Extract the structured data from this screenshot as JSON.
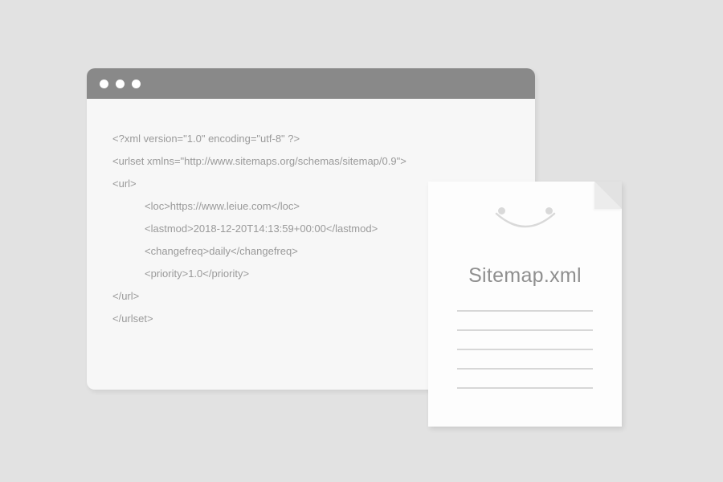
{
  "code": {
    "l1": "<?xml version=\"1.0\" encoding=\"utf-8\" ?>",
    "l2": "<urlset xmlns=\"http://www.sitemaps.org/schemas/sitemap/0.9\">",
    "l3": "<url>",
    "l4": "<loc>https://www.leiue.com</loc>",
    "l5": "<lastmod>2018-12-20T14:13:59+00:00</lastmod>",
    "l6": "<changefreq>daily</changefreq>",
    "l7": "<priority>1.0</priority>",
    "l8": "</url>",
    "l9": "</urlset>"
  },
  "document": {
    "title": "Sitemap.xml"
  }
}
